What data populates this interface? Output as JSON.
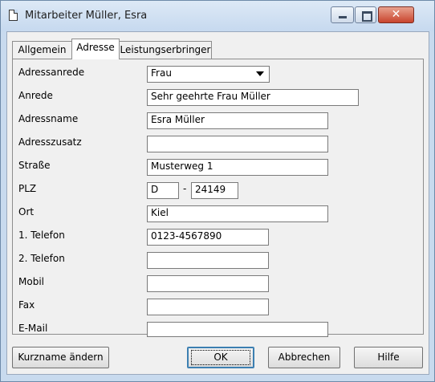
{
  "window": {
    "title": "Mitarbeiter Müller, Esra",
    "icons": {
      "app": "document-icon",
      "minimize": "minimize-icon",
      "maximize": "maximize-icon",
      "close": "close-icon"
    },
    "close_glyph": "✕"
  },
  "tabs": [
    {
      "label": "Allgemein",
      "active": false
    },
    {
      "label": "Adresse",
      "active": true
    },
    {
      "label": "Leistungserbringer",
      "active": false
    }
  ],
  "form": {
    "adressanrede": {
      "label": "Adressanrede",
      "value": "Frau"
    },
    "anrede": {
      "label": "Anrede",
      "value": "Sehr geehrte Frau Müller"
    },
    "adressname": {
      "label": "Adressname",
      "value": "Esra Müller"
    },
    "adresszusatz": {
      "label": "Adresszusatz",
      "value": ""
    },
    "strasse": {
      "label": "Straße",
      "value": "Musterweg 1"
    },
    "plz": {
      "label": "PLZ",
      "country": "D",
      "separator": "-",
      "value": "24149"
    },
    "ort": {
      "label": "Ort",
      "value": "Kiel"
    },
    "telefon1": {
      "label": "1. Telefon",
      "value": "0123-4567890"
    },
    "telefon2": {
      "label": "2. Telefon",
      "value": ""
    },
    "mobil": {
      "label": "Mobil",
      "value": ""
    },
    "fax": {
      "label": "Fax",
      "value": ""
    },
    "email": {
      "label": "E-Mail",
      "value": ""
    }
  },
  "buttons": {
    "kurzname": "Kurzname ändern",
    "ok": "OK",
    "abbrechen": "Abbrechen",
    "hilfe": "Hilfe"
  },
  "colors": {
    "titlebar": "#c6d9ef",
    "close_button": "#c8442d",
    "dialog_bg": "#f0f0f0"
  }
}
